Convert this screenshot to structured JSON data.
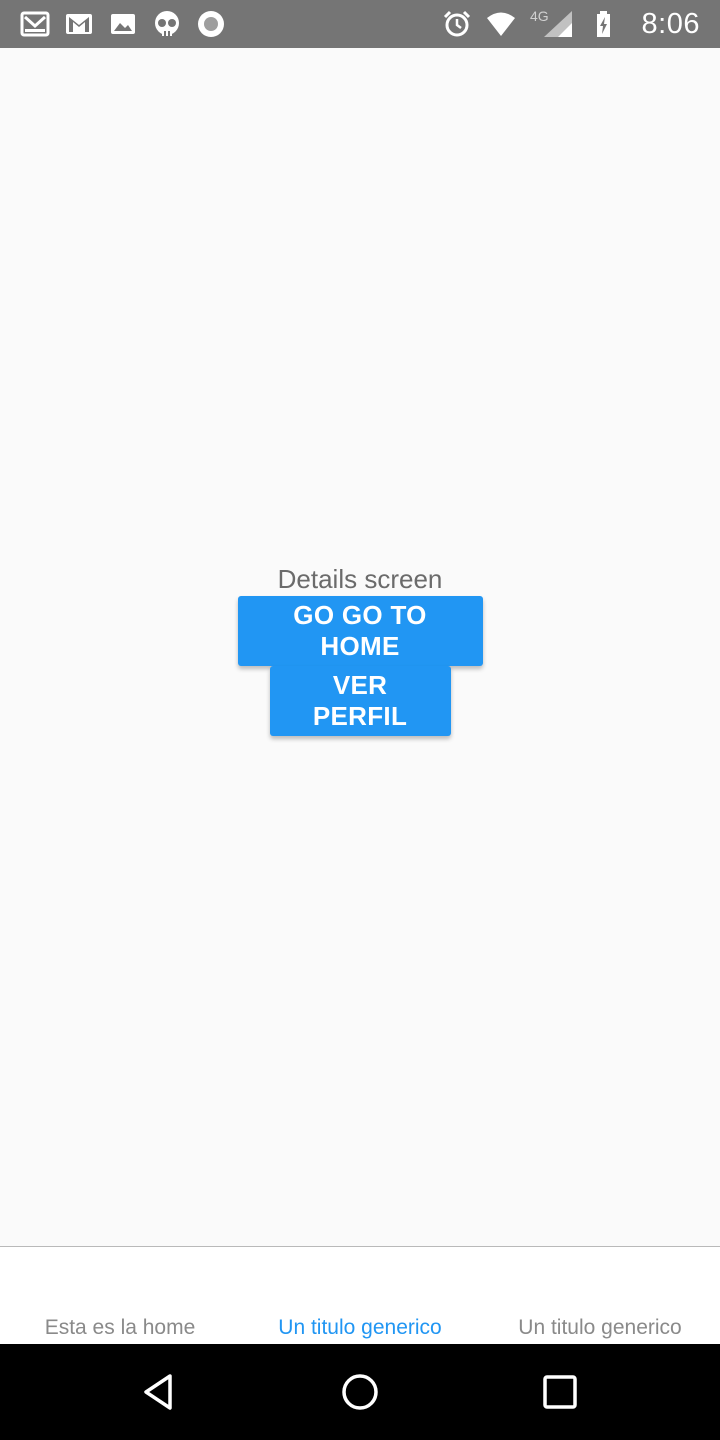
{
  "status_bar": {
    "time": "8:06",
    "network": "4G",
    "left_icons": [
      "gmail-icon",
      "gmail-icon",
      "photo-icon",
      "skull-icon",
      "record-icon"
    ],
    "right_icons": [
      "alarm-icon",
      "wifi-icon",
      "signal-icon",
      "battery-charging-icon"
    ]
  },
  "main": {
    "title": "Details screen",
    "buttons": {
      "go_home": "GO GO TO HOME",
      "ver_perfil": "VER PERFIL"
    }
  },
  "tabs": [
    {
      "label": "Esta es la home",
      "active": false
    },
    {
      "label": "Un titulo generico",
      "active": true
    },
    {
      "label": "Un titulo generico",
      "active": false
    }
  ],
  "nav": {
    "buttons": [
      "back-icon",
      "home-icon",
      "recents-icon"
    ]
  },
  "colors": {
    "accent": "#2196f3",
    "status_bar": "#757575",
    "background": "#fafafa",
    "tab_inactive": "#8a8a8a"
  }
}
